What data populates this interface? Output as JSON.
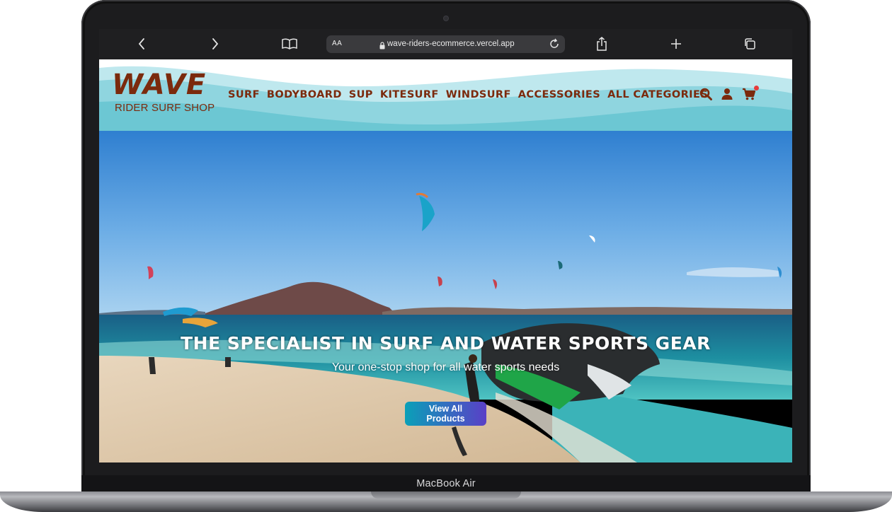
{
  "device": {
    "label": "MacBook Air"
  },
  "browser": {
    "text_size_label": "AA",
    "url": "wave-riders-ecommerce.vercel.app",
    "icons": [
      "back-icon",
      "forward-icon",
      "reader-icon",
      "lock-icon",
      "reload-icon",
      "share-icon",
      "new-tab-icon",
      "tabs-icon"
    ]
  },
  "site": {
    "logo": {
      "title": "WAVE",
      "subtitle": "RIDER SURF SHOP"
    },
    "nav": [
      {
        "label": "SURF"
      },
      {
        "label": "BODYBOARD"
      },
      {
        "label": "SUP"
      },
      {
        "label": "KITESURF"
      },
      {
        "label": "WINDSURF"
      },
      {
        "label": "ACCESSORIES"
      },
      {
        "label": "ALL CATEGORIES"
      }
    ],
    "header_icons": [
      "search-icon",
      "user-icon",
      "cart-icon"
    ],
    "colors": {
      "brand": "#7b2a0d",
      "accent_start": "#0aa0b8",
      "accent_end": "#5a3fc7",
      "wave": "#6cc7d3",
      "cart_badge": "#e63c3c"
    }
  },
  "hero": {
    "title": "THE SPECIALIST IN SURF AND WATER SPORTS GEAR",
    "subtitle": "Your one-stop shop for all water sports needs",
    "button_label": "View All Products"
  }
}
